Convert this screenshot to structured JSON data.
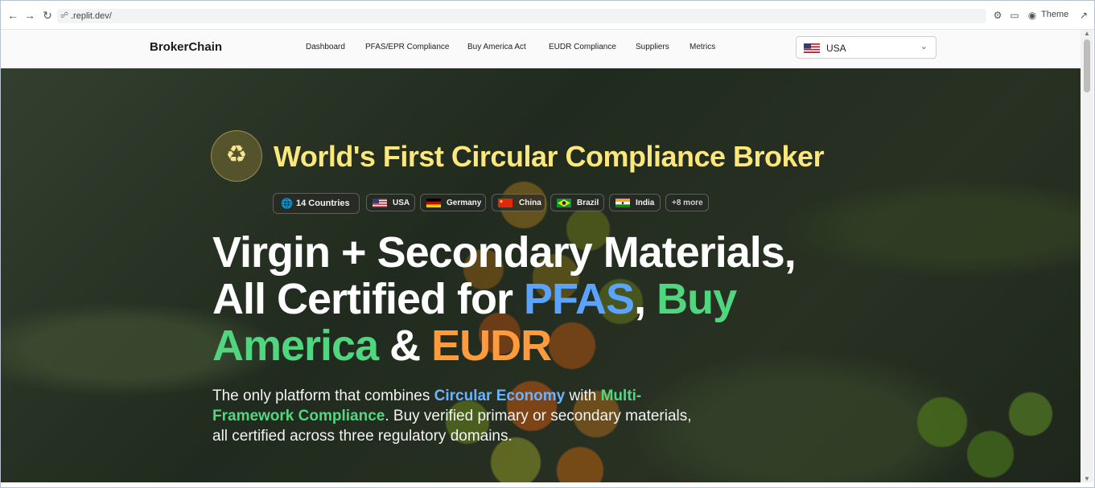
{
  "browser": {
    "url": ".replit.dev/",
    "theme_label": "Theme"
  },
  "header": {
    "brand": "BrokerChain",
    "nav": [
      "Dashboard",
      "PFAS/EPR Compliance",
      "Buy America Act",
      "EUDR Compliance",
      "Suppliers",
      "Metrics"
    ],
    "country_select": {
      "value": "USA",
      "flag": "us-flag-icon"
    }
  },
  "hero": {
    "tagline": "World's First Circular Compliance Broker",
    "countries_badge": "14 Countries",
    "country_chips": [
      {
        "label": "USA",
        "flag": "us-flag-icon"
      },
      {
        "label": "Germany",
        "flag": "de-flag-icon"
      },
      {
        "label": "China",
        "flag": "cn-flag-icon"
      },
      {
        "label": "Brazil",
        "flag": "br-flag-icon"
      },
      {
        "label": "India",
        "flag": "in-flag-icon"
      }
    ],
    "more_chip": "+8 more",
    "headline": {
      "part1": "Virgin + Secondary Materials,",
      "part2": "All Certified for ",
      "pfas": "PFAS",
      "comma": ", ",
      "buy": "Buy",
      "america": "America",
      "amp": " & ",
      "eudr": "EUDR"
    },
    "subtext": {
      "a": "The only platform that combines ",
      "circular": "Circular Economy",
      "b": " with ",
      "multi": "Multi-Framework Compliance",
      "c": ". Buy verified primary or secondary materials, all certified across three regulatory domains."
    }
  },
  "colors": {
    "accent_yellow": "#fbe77c",
    "pfas_blue": "#5aa3ff",
    "buy_america_green": "#4fd67e",
    "eudr_orange": "#ff9a3d"
  }
}
